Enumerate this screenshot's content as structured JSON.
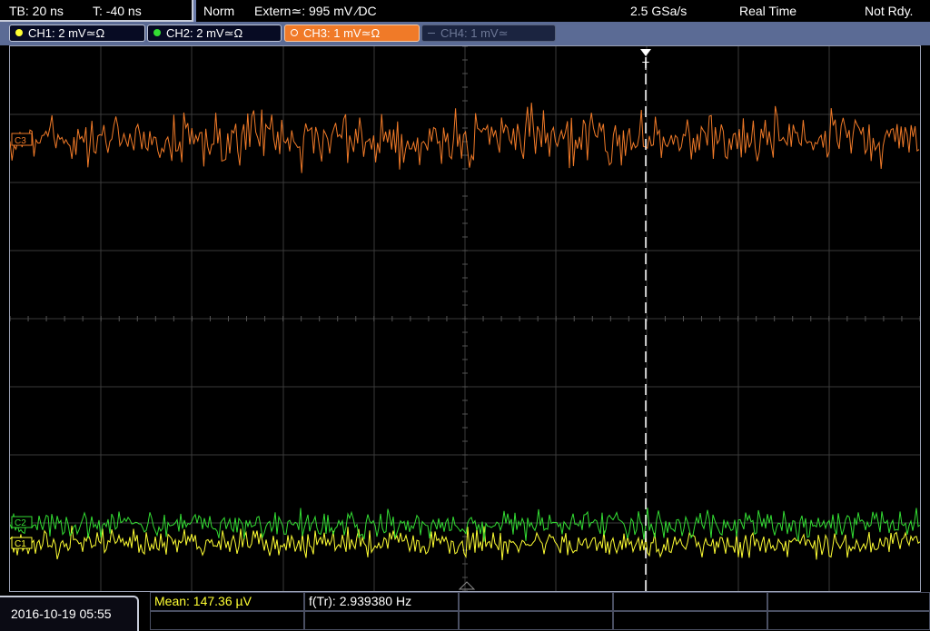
{
  "topbar": {
    "timebase": "TB: 20 ns",
    "trigger_offset": "T: -40 ns",
    "acq_mode": "Norm",
    "trigger_source": "Extern≃: 995 mV ∕DC",
    "sample_rate": "2.5 GSa/s",
    "mode": "Real Time",
    "status": "Not Rdy."
  },
  "channels": [
    {
      "label": "CH1: 2 mV≃Ω",
      "color": "#ffff33",
      "state": "on"
    },
    {
      "label": "CH2: 2 mV≃Ω",
      "color": "#33dd33",
      "state": "on"
    },
    {
      "label": "CH3: 1 mV≃Ω",
      "color": "#f07a28",
      "state": "selected"
    },
    {
      "label": "CH4: 1 mV≃",
      "color": "#6d7896",
      "state": "off"
    }
  ],
  "trigger_marker": "T",
  "markers": {
    "ch1": "C1",
    "ch2": "C2",
    "ch3": "C3"
  },
  "measurements": {
    "mean": "Mean: 147.36 µV",
    "frequency": "f(Tr): 2.939380 Hz"
  },
  "datetime": "2016-10-19  05:55",
  "colors": {
    "ch1": "#ffff33",
    "ch2": "#33dd33",
    "ch3": "#f07a28",
    "grid": "#3a3a3a",
    "panel": "#5b6b95"
  }
}
